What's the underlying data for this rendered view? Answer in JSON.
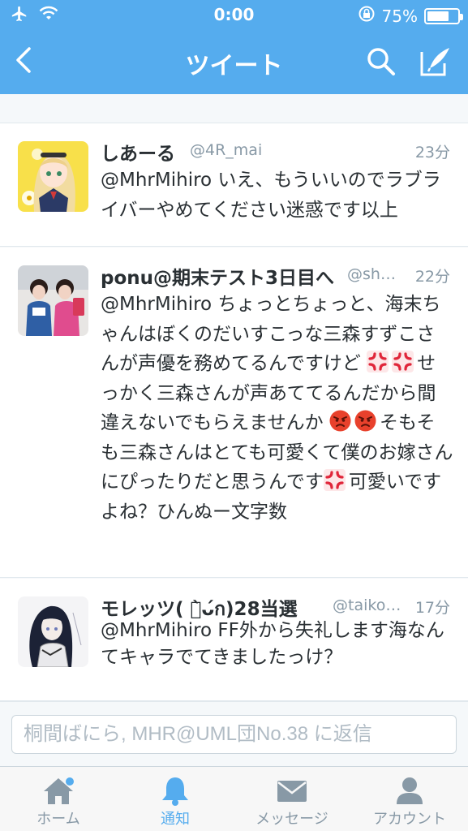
{
  "status_bar": {
    "time": "0:00",
    "battery": "75%",
    "battery_level": 0.75
  },
  "nav": {
    "title": "ツイート"
  },
  "tweets": [
    {
      "name": "しあーる",
      "handle": "@4R_mai",
      "time": "23分",
      "text": "@MhrMihiro いえ、もういいのでラブライバーやめてください迷惑です以上"
    },
    {
      "name": "ponu@期末テスト3日目へ",
      "handle": "@sh…",
      "time": "22分",
      "segments": [
        "@MhrMihiro ちょっとちょっと、海末ちゃんはぼくのだいすこっな三森すずこさんが声優を務めてるんですけど",
        "せっかく三森さんが声あててるんだから間違えないでもらえませんか",
        "そもそも三森さんはとても可愛くて僕のお嫁さんにぴったりだと思うんです",
        "可愛いですよね？ひんぬー文字数"
      ],
      "emoji": [
        "anger-symbol",
        "angry-face"
      ]
    },
    {
      "name": "モレッツ( ก̀ᴗ́ก)28当選",
      "handle": "@taiko…",
      "time": "17分",
      "text": "@MhrMihiro FF外から失礼します海なんてキャラでてきましたっけ？"
    }
  ],
  "reply": {
    "placeholder": "桐間ばにら, MHR@UML団No.38 に返信"
  },
  "tabs": [
    {
      "label": "ホーム",
      "icon": "home-icon",
      "active": false
    },
    {
      "label": "通知",
      "icon": "bell-icon",
      "active": true
    },
    {
      "label": "メッセージ",
      "icon": "envelope-icon",
      "active": false
    },
    {
      "label": "アカウント",
      "icon": "person-icon",
      "active": false
    }
  ],
  "colors": {
    "accent": "#55acee",
    "text": "#292f33",
    "muted": "#8899a6",
    "anger": "#e0263a",
    "angry_face": "#e8412c"
  }
}
